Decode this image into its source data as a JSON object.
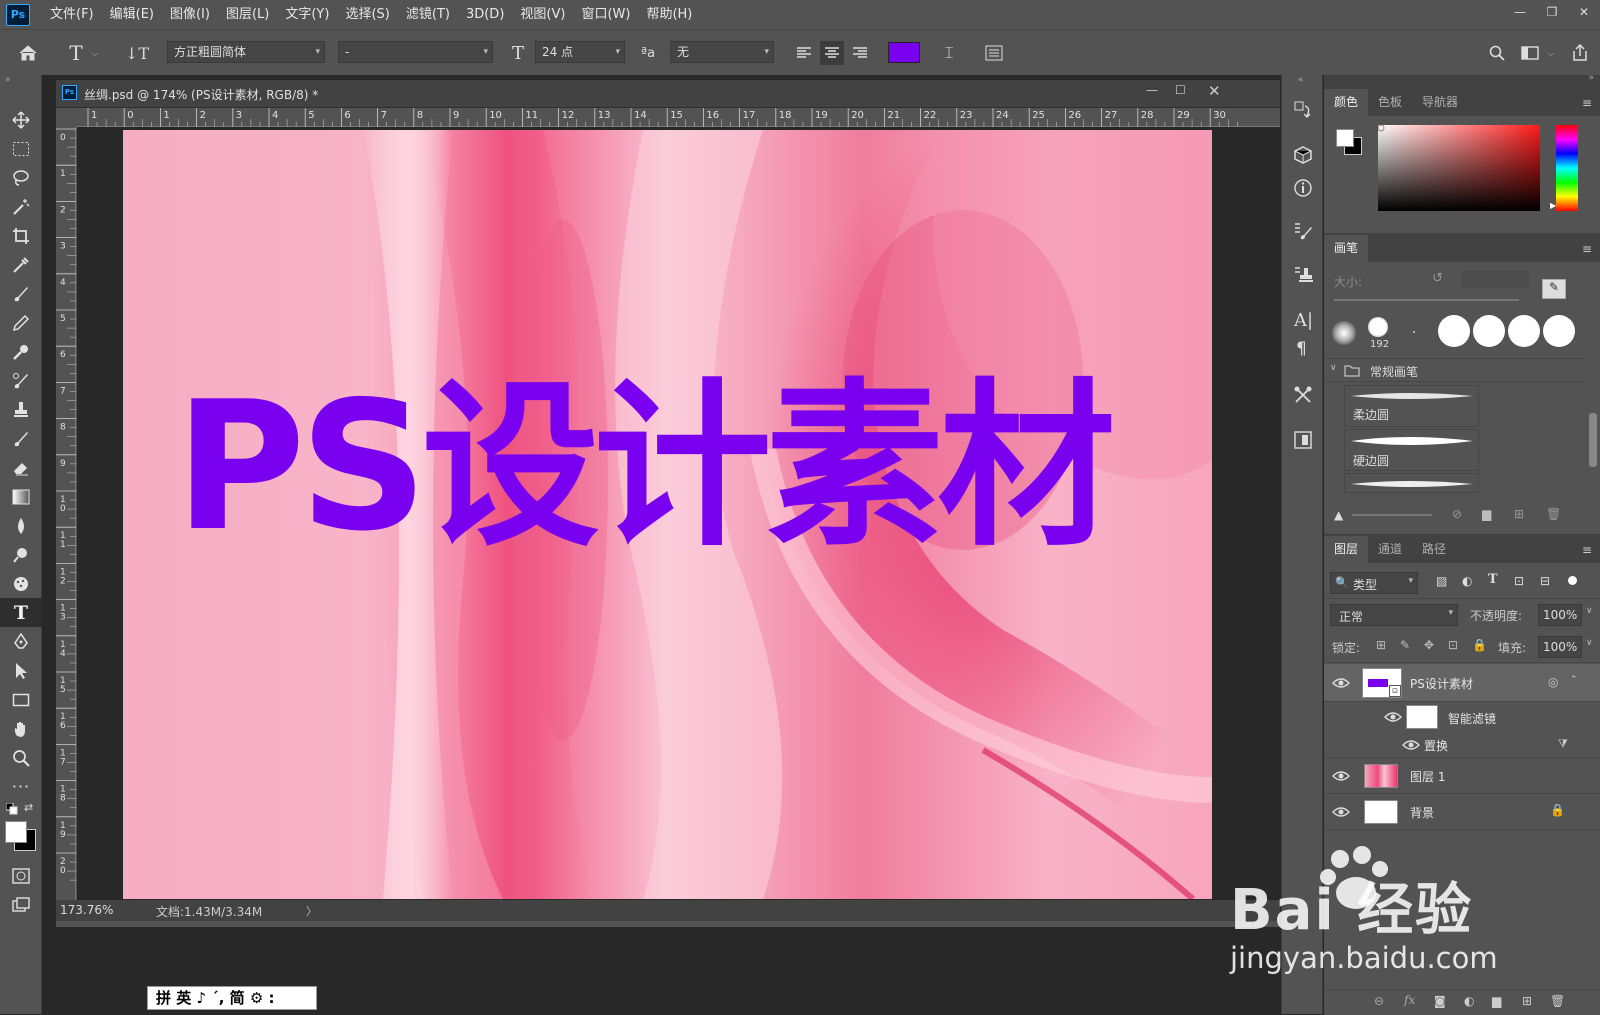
{
  "app": {
    "logo": "Ps"
  },
  "menu": [
    "文件(F)",
    "编辑(E)",
    "图像(I)",
    "图层(L)",
    "文字(Y)",
    "选择(S)",
    "滤镜(T)",
    "3D(D)",
    "视图(V)",
    "窗口(W)",
    "帮助(H)"
  ],
  "options": {
    "font_family": "方正粗圆简体",
    "font_style": "-",
    "font_size": "24 点",
    "antialias": "无",
    "text_color": "#7a00f0"
  },
  "document": {
    "title": "丝绸.psd @ 174% (PS设计素材, RGB/8) *",
    "canvas_text": "PS设计素材",
    "text_color": "#7a00f0",
    "ruler_h": [
      "1",
      "0",
      "1",
      "2",
      "3",
      "4",
      "5",
      "6",
      "7",
      "8",
      "9",
      "10",
      "11",
      "12",
      "13",
      "14",
      "15",
      "16",
      "17",
      "18",
      "19",
      "20",
      "21",
      "22",
      "23",
      "24",
      "25",
      "26",
      "27",
      "28",
      "29",
      "30"
    ],
    "ruler_v": [
      "0",
      "1",
      "2",
      "3",
      "4",
      "5",
      "6",
      "7",
      "8",
      "9",
      "10",
      "11",
      "12",
      "13",
      "14",
      "15",
      "16",
      "17",
      "18",
      "19",
      "20"
    ]
  },
  "status": {
    "zoom": "173.76%",
    "doc": "文档:1.43M/3.34M"
  },
  "color_panel": {
    "tabs": [
      "颜色",
      "色板",
      "导航器"
    ]
  },
  "brush_panel": {
    "title": "画笔",
    "size_label": "大小:",
    "preset_size": "192",
    "folder": "常规画笔",
    "brushes": [
      "柔边圆",
      "硬边圆"
    ]
  },
  "layers_panel": {
    "tabs": [
      "图层",
      "通道",
      "路径"
    ],
    "filter": "类型",
    "blend_mode": "正常",
    "opacity_label": "不透明度:",
    "opacity": "100%",
    "lock_label": "锁定:",
    "fill_label": "填充:",
    "fill": "100%",
    "layers": [
      {
        "name": "PS设计素材"
      },
      {
        "name": "智能滤镜"
      },
      {
        "name": "置换"
      },
      {
        "name": "图层 1"
      },
      {
        "name": "背景"
      }
    ]
  },
  "ime_bar": "拼 英 ♪ ˊ, 简 ⚙ :",
  "watermark": {
    "brand": "Bai 经验",
    "url": "jingyan.baidu.com"
  }
}
